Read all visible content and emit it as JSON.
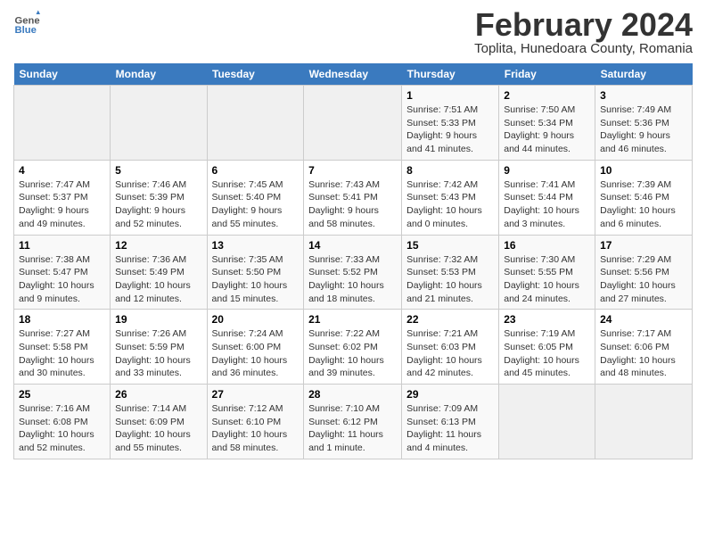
{
  "header": {
    "logo_line1": "General",
    "logo_line2": "Blue",
    "month_title": "February 2024",
    "location": "Toplita, Hunedoara County, Romania"
  },
  "weekdays": [
    "Sunday",
    "Monday",
    "Tuesday",
    "Wednesday",
    "Thursday",
    "Friday",
    "Saturday"
  ],
  "weeks": [
    [
      {
        "day": "",
        "info": ""
      },
      {
        "day": "",
        "info": ""
      },
      {
        "day": "",
        "info": ""
      },
      {
        "day": "",
        "info": ""
      },
      {
        "day": "1",
        "info": "Sunrise: 7:51 AM\nSunset: 5:33 PM\nDaylight: 9 hours and 41 minutes."
      },
      {
        "day": "2",
        "info": "Sunrise: 7:50 AM\nSunset: 5:34 PM\nDaylight: 9 hours and 44 minutes."
      },
      {
        "day": "3",
        "info": "Sunrise: 7:49 AM\nSunset: 5:36 PM\nDaylight: 9 hours and 46 minutes."
      }
    ],
    [
      {
        "day": "4",
        "info": "Sunrise: 7:47 AM\nSunset: 5:37 PM\nDaylight: 9 hours and 49 minutes."
      },
      {
        "day": "5",
        "info": "Sunrise: 7:46 AM\nSunset: 5:39 PM\nDaylight: 9 hours and 52 minutes."
      },
      {
        "day": "6",
        "info": "Sunrise: 7:45 AM\nSunset: 5:40 PM\nDaylight: 9 hours and 55 minutes."
      },
      {
        "day": "7",
        "info": "Sunrise: 7:43 AM\nSunset: 5:41 PM\nDaylight: 9 hours and 58 minutes."
      },
      {
        "day": "8",
        "info": "Sunrise: 7:42 AM\nSunset: 5:43 PM\nDaylight: 10 hours and 0 minutes."
      },
      {
        "day": "9",
        "info": "Sunrise: 7:41 AM\nSunset: 5:44 PM\nDaylight: 10 hours and 3 minutes."
      },
      {
        "day": "10",
        "info": "Sunrise: 7:39 AM\nSunset: 5:46 PM\nDaylight: 10 hours and 6 minutes."
      }
    ],
    [
      {
        "day": "11",
        "info": "Sunrise: 7:38 AM\nSunset: 5:47 PM\nDaylight: 10 hours and 9 minutes."
      },
      {
        "day": "12",
        "info": "Sunrise: 7:36 AM\nSunset: 5:49 PM\nDaylight: 10 hours and 12 minutes."
      },
      {
        "day": "13",
        "info": "Sunrise: 7:35 AM\nSunset: 5:50 PM\nDaylight: 10 hours and 15 minutes."
      },
      {
        "day": "14",
        "info": "Sunrise: 7:33 AM\nSunset: 5:52 PM\nDaylight: 10 hours and 18 minutes."
      },
      {
        "day": "15",
        "info": "Sunrise: 7:32 AM\nSunset: 5:53 PM\nDaylight: 10 hours and 21 minutes."
      },
      {
        "day": "16",
        "info": "Sunrise: 7:30 AM\nSunset: 5:55 PM\nDaylight: 10 hours and 24 minutes."
      },
      {
        "day": "17",
        "info": "Sunrise: 7:29 AM\nSunset: 5:56 PM\nDaylight: 10 hours and 27 minutes."
      }
    ],
    [
      {
        "day": "18",
        "info": "Sunrise: 7:27 AM\nSunset: 5:58 PM\nDaylight: 10 hours and 30 minutes."
      },
      {
        "day": "19",
        "info": "Sunrise: 7:26 AM\nSunset: 5:59 PM\nDaylight: 10 hours and 33 minutes."
      },
      {
        "day": "20",
        "info": "Sunrise: 7:24 AM\nSunset: 6:00 PM\nDaylight: 10 hours and 36 minutes."
      },
      {
        "day": "21",
        "info": "Sunrise: 7:22 AM\nSunset: 6:02 PM\nDaylight: 10 hours and 39 minutes."
      },
      {
        "day": "22",
        "info": "Sunrise: 7:21 AM\nSunset: 6:03 PM\nDaylight: 10 hours and 42 minutes."
      },
      {
        "day": "23",
        "info": "Sunrise: 7:19 AM\nSunset: 6:05 PM\nDaylight: 10 hours and 45 minutes."
      },
      {
        "day": "24",
        "info": "Sunrise: 7:17 AM\nSunset: 6:06 PM\nDaylight: 10 hours and 48 minutes."
      }
    ],
    [
      {
        "day": "25",
        "info": "Sunrise: 7:16 AM\nSunset: 6:08 PM\nDaylight: 10 hours and 52 minutes."
      },
      {
        "day": "26",
        "info": "Sunrise: 7:14 AM\nSunset: 6:09 PM\nDaylight: 10 hours and 55 minutes."
      },
      {
        "day": "27",
        "info": "Sunrise: 7:12 AM\nSunset: 6:10 PM\nDaylight: 10 hours and 58 minutes."
      },
      {
        "day": "28",
        "info": "Sunrise: 7:10 AM\nSunset: 6:12 PM\nDaylight: 11 hours and 1 minute."
      },
      {
        "day": "29",
        "info": "Sunrise: 7:09 AM\nSunset: 6:13 PM\nDaylight: 11 hours and 4 minutes."
      },
      {
        "day": "",
        "info": ""
      },
      {
        "day": "",
        "info": ""
      }
    ]
  ]
}
